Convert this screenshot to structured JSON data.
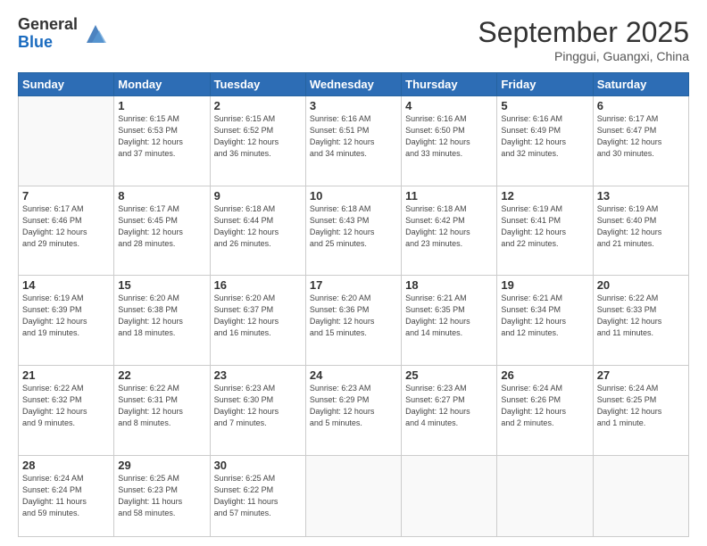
{
  "logo": {
    "general": "General",
    "blue": "Blue"
  },
  "header": {
    "month": "September 2025",
    "location": "Pinggui, Guangxi, China"
  },
  "days_of_week": [
    "Sunday",
    "Monday",
    "Tuesday",
    "Wednesday",
    "Thursday",
    "Friday",
    "Saturday"
  ],
  "weeks": [
    [
      {
        "day": "",
        "info": ""
      },
      {
        "day": "1",
        "info": "Sunrise: 6:15 AM\nSunset: 6:53 PM\nDaylight: 12 hours\nand 37 minutes."
      },
      {
        "day": "2",
        "info": "Sunrise: 6:15 AM\nSunset: 6:52 PM\nDaylight: 12 hours\nand 36 minutes."
      },
      {
        "day": "3",
        "info": "Sunrise: 6:16 AM\nSunset: 6:51 PM\nDaylight: 12 hours\nand 34 minutes."
      },
      {
        "day": "4",
        "info": "Sunrise: 6:16 AM\nSunset: 6:50 PM\nDaylight: 12 hours\nand 33 minutes."
      },
      {
        "day": "5",
        "info": "Sunrise: 6:16 AM\nSunset: 6:49 PM\nDaylight: 12 hours\nand 32 minutes."
      },
      {
        "day": "6",
        "info": "Sunrise: 6:17 AM\nSunset: 6:47 PM\nDaylight: 12 hours\nand 30 minutes."
      }
    ],
    [
      {
        "day": "7",
        "info": "Sunrise: 6:17 AM\nSunset: 6:46 PM\nDaylight: 12 hours\nand 29 minutes."
      },
      {
        "day": "8",
        "info": "Sunrise: 6:17 AM\nSunset: 6:45 PM\nDaylight: 12 hours\nand 28 minutes."
      },
      {
        "day": "9",
        "info": "Sunrise: 6:18 AM\nSunset: 6:44 PM\nDaylight: 12 hours\nand 26 minutes."
      },
      {
        "day": "10",
        "info": "Sunrise: 6:18 AM\nSunset: 6:43 PM\nDaylight: 12 hours\nand 25 minutes."
      },
      {
        "day": "11",
        "info": "Sunrise: 6:18 AM\nSunset: 6:42 PM\nDaylight: 12 hours\nand 23 minutes."
      },
      {
        "day": "12",
        "info": "Sunrise: 6:19 AM\nSunset: 6:41 PM\nDaylight: 12 hours\nand 22 minutes."
      },
      {
        "day": "13",
        "info": "Sunrise: 6:19 AM\nSunset: 6:40 PM\nDaylight: 12 hours\nand 21 minutes."
      }
    ],
    [
      {
        "day": "14",
        "info": "Sunrise: 6:19 AM\nSunset: 6:39 PM\nDaylight: 12 hours\nand 19 minutes."
      },
      {
        "day": "15",
        "info": "Sunrise: 6:20 AM\nSunset: 6:38 PM\nDaylight: 12 hours\nand 18 minutes."
      },
      {
        "day": "16",
        "info": "Sunrise: 6:20 AM\nSunset: 6:37 PM\nDaylight: 12 hours\nand 16 minutes."
      },
      {
        "day": "17",
        "info": "Sunrise: 6:20 AM\nSunset: 6:36 PM\nDaylight: 12 hours\nand 15 minutes."
      },
      {
        "day": "18",
        "info": "Sunrise: 6:21 AM\nSunset: 6:35 PM\nDaylight: 12 hours\nand 14 minutes."
      },
      {
        "day": "19",
        "info": "Sunrise: 6:21 AM\nSunset: 6:34 PM\nDaylight: 12 hours\nand 12 minutes."
      },
      {
        "day": "20",
        "info": "Sunrise: 6:22 AM\nSunset: 6:33 PM\nDaylight: 12 hours\nand 11 minutes."
      }
    ],
    [
      {
        "day": "21",
        "info": "Sunrise: 6:22 AM\nSunset: 6:32 PM\nDaylight: 12 hours\nand 9 minutes."
      },
      {
        "day": "22",
        "info": "Sunrise: 6:22 AM\nSunset: 6:31 PM\nDaylight: 12 hours\nand 8 minutes."
      },
      {
        "day": "23",
        "info": "Sunrise: 6:23 AM\nSunset: 6:30 PM\nDaylight: 12 hours\nand 7 minutes."
      },
      {
        "day": "24",
        "info": "Sunrise: 6:23 AM\nSunset: 6:29 PM\nDaylight: 12 hours\nand 5 minutes."
      },
      {
        "day": "25",
        "info": "Sunrise: 6:23 AM\nSunset: 6:27 PM\nDaylight: 12 hours\nand 4 minutes."
      },
      {
        "day": "26",
        "info": "Sunrise: 6:24 AM\nSunset: 6:26 PM\nDaylight: 12 hours\nand 2 minutes."
      },
      {
        "day": "27",
        "info": "Sunrise: 6:24 AM\nSunset: 6:25 PM\nDaylight: 12 hours\nand 1 minute."
      }
    ],
    [
      {
        "day": "28",
        "info": "Sunrise: 6:24 AM\nSunset: 6:24 PM\nDaylight: 11 hours\nand 59 minutes."
      },
      {
        "day": "29",
        "info": "Sunrise: 6:25 AM\nSunset: 6:23 PM\nDaylight: 11 hours\nand 58 minutes."
      },
      {
        "day": "30",
        "info": "Sunrise: 6:25 AM\nSunset: 6:22 PM\nDaylight: 11 hours\nand 57 minutes."
      },
      {
        "day": "",
        "info": ""
      },
      {
        "day": "",
        "info": ""
      },
      {
        "day": "",
        "info": ""
      },
      {
        "day": "",
        "info": ""
      }
    ]
  ]
}
